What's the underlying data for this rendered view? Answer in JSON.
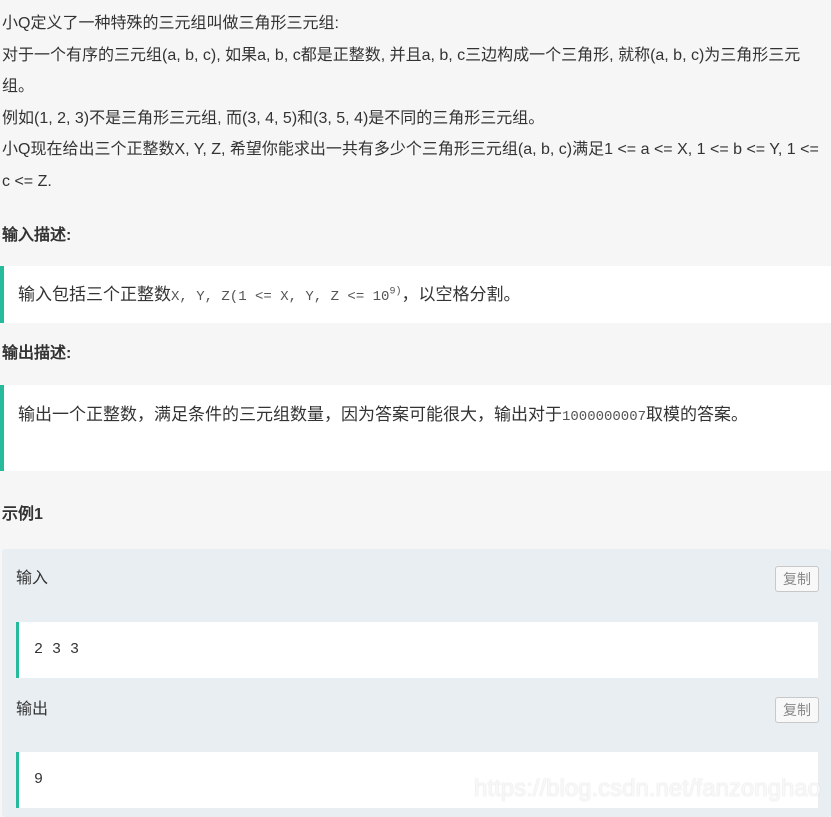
{
  "description": {
    "line1": "小Q定义了一种特殊的三元组叫做三角形三元组:",
    "line2": "对于一个有序的三元组(a, b, c), 如果a, b, c都是正整数, 并且a, b, c三边构成一个三角形, 就称(a, b, c)为三角形三元组。",
    "line3": "例如(1, 2, 3)不是三角形三元组, 而(3, 4, 5)和(3, 5, 4)是不同的三角形三元组。",
    "line4": "小Q现在给出三个正整数X, Y, Z, 希望你能求出一共有多少个三角形三元组(a, b, c)满足1 <= a <= X, 1 <= b <= Y, 1 <= c <= Z."
  },
  "input_section": {
    "heading": "输入描述:",
    "text_before": "输入包括三个正整数",
    "mono_part": "X, Y, Z(1 <= X, Y, Z <= 10",
    "exponent": "9)",
    "text_after": "，以空格分割。"
  },
  "output_section": {
    "heading": "输出描述:",
    "text_before": "输出一个正整数，满足条件的三元组数量，因为答案可能很大，输出对于",
    "mono_part": "1000000007",
    "text_after": "取模的答案。"
  },
  "example": {
    "heading": "示例1",
    "input_label": "输入",
    "input_value": "2 3 3",
    "output_label": "输出",
    "output_value": "9",
    "copy_label": "复制"
  },
  "watermark": "https://blog.csdn.net/fanzonghao",
  "colors": {
    "accent": "#25bb9b",
    "page_bg": "#f6f6f6",
    "example_bg": "#e9eef3"
  }
}
